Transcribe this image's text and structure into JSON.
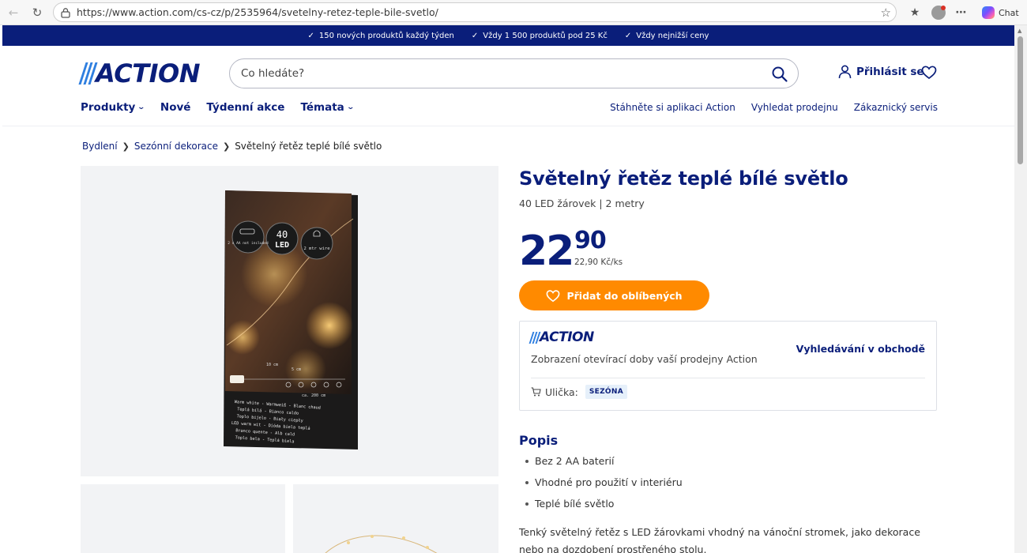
{
  "browser": {
    "url": "https://www.action.com/cs-cz/p/2535964/svetelny-retez-teple-bile-svetlo/",
    "chat_label": "Chat"
  },
  "usp": [
    "150 nových produktů každý týden",
    "Vždy 1 500 produktů pod 25 Kč",
    "Vždy nejnižší ceny"
  ],
  "header": {
    "logo": "ACTION",
    "search_placeholder": "Co hledáte?",
    "login_label": "Přihlásit se"
  },
  "menu": {
    "items": [
      "Produkty",
      "Nové",
      "Týdenní akce",
      "Témata"
    ],
    "utility_links": [
      "Stáhněte si aplikaci Action",
      "Vyhledat prodejnu",
      "Zákaznický servis"
    ]
  },
  "breadcrumb": [
    "Bydlení",
    "Sezónní dekorace",
    "Světelný řetěz teplé bílé světlo"
  ],
  "product": {
    "title": "Světelný řetěz teplé bílé světlo",
    "subtitle": "40 LED žárovek | 2 metry",
    "price_integer": "22",
    "price_decimal": "90",
    "unit_price": "22,90 Kč/ks",
    "favorite_label": "Přidat do oblíbených",
    "package_text": {
      "battery": "2 x AA not included",
      "led_count": "40",
      "led": "LED",
      "wire": "2 mtr wire",
      "dim_short": "10 cm",
      "dim_mid": "5 cm",
      "dim_long": "ca. 200 cm",
      "labels": [
        "Warm white - Warmweiß - Blanc chaud",
        "Teplá bílá - Bianco caldo",
        "Toplo bijelo - Biały ciepły",
        "LED warm wit - Dióda biela teplá",
        "Branco quente - Alb cald",
        "Toplo bela - Teplá biela"
      ]
    }
  },
  "store": {
    "logo": "ACTION",
    "description": "Zobrazení otevírací doby vaší prodejny Action",
    "link": "Vyhledávání v obchodě",
    "aisle_label": "Ulička:",
    "aisle_value": "SEZÓNA"
  },
  "description": {
    "title": "Popis",
    "bullets": [
      "Bez 2 AA baterií",
      "Vhodné pro použití v interiéru",
      "Teplé bílé světlo"
    ],
    "text": "Tenký světelný řetěz s LED žárovkami vhodný na vánoční stromek, jako dekorace nebo na dozdobení prostřeného stolu."
  },
  "colors": {
    "brand_navy": "#0a1e7a",
    "brand_blue": "#2f7fe0",
    "accent_orange": "#ff8a00"
  }
}
